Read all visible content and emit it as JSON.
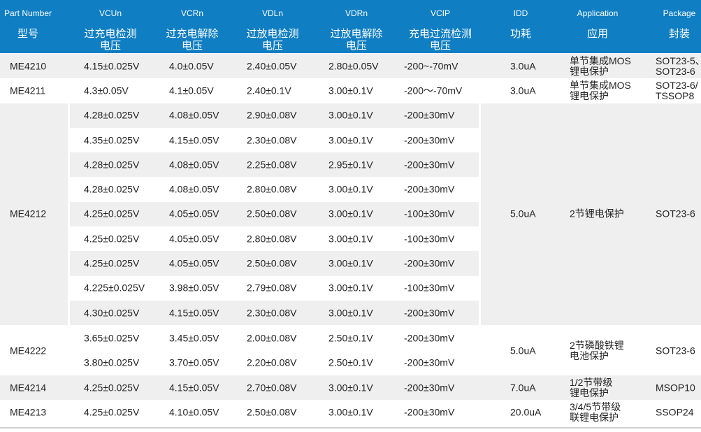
{
  "header": {
    "en": [
      "Part Number",
      "VCUn",
      "VCRn",
      "VDLn",
      "VDRn",
      "VCIP",
      "IDD",
      "Application",
      "Package"
    ],
    "zh": [
      "型号",
      "过充电检测\n电压",
      "过充电解除\n电压",
      "过放电检测\n电压",
      "过放电解除\n电压",
      "充电过流检测\n电压",
      "功耗",
      "应用",
      "封装"
    ]
  },
  "groups": [
    {
      "part": "ME4210",
      "rows": [
        [
          "4.15±0.025V",
          "4.0±0.05V",
          "2.40±0.05V",
          "2.80±0.05V",
          "-200~-70mV"
        ]
      ],
      "idd": "3.0uA",
      "application": "单节集成MOS\n锂电保护",
      "package": "SOT23-5、\nSOT23-6"
    },
    {
      "part": "ME4211",
      "rows": [
        [
          "4.3±0.05V",
          "4.1±0.05V",
          "2.40±0.1V",
          "3.00±0.1V",
          "-200～-70mV"
        ]
      ],
      "idd": "3.0uA",
      "application": "单节集成MOS\n锂电保护",
      "package": "SOT23-6/\nTSSOP8"
    },
    {
      "part": "ME4212",
      "rows": [
        [
          "4.28±0.025V",
          "4.08±0.05V",
          "2.90±0.08V",
          "3.00±0.1V",
          "-200±30mV"
        ],
        [
          "4.35±0.025V",
          "4.15±0.05V",
          "2.30±0.08V",
          "3.00±0.1V",
          "-200±30mV"
        ],
        [
          "4.28±0.025V",
          "4.08±0.05V",
          "2.25±0.08V",
          "2.95±0.1V",
          "-200±30mV"
        ],
        [
          "4.28±0.025V",
          "4.08±0.05V",
          "2.80±0.08V",
          "3.00±0.1V",
          "-200±30mV"
        ],
        [
          "4.25±0.025V",
          "4.05±0.05V",
          "2.50±0.08V",
          "3.00±0.1V",
          "-100±30mV"
        ],
        [
          "4.25±0.025V",
          "4.05±0.05V",
          "2.80±0.08V",
          "3.00±0.1V",
          "-100±30mV"
        ],
        [
          "4.25±0.025V",
          "4.05±0.05V",
          "2.50±0.08V",
          "3.00±0.1V",
          "-200±30mV"
        ],
        [
          "4.225±0.025V",
          "3.98±0.05V",
          "2.79±0.08V",
          "3.00±0.1V",
          "-100±30mV"
        ],
        [
          "4.30±0.025V",
          "4.15±0.05V",
          "2.30±0.08V",
          "3.00±0.1V",
          "-200±30mV"
        ]
      ],
      "idd": "5.0uA",
      "application": "2节锂电保护",
      "package": "SOT23-6"
    },
    {
      "part": "ME4222",
      "rows": [
        [
          "3.65±0.025V",
          "3.45±0.05V",
          "2.00±0.08V",
          "2.50±0.1V",
          "-200±30mV"
        ],
        [
          "3.80±0.025V",
          "3.70±0.05V",
          "2.20±0.08V",
          "2.50±0.1V",
          "-200±30mV"
        ]
      ],
      "idd": "5.0uA",
      "application": "2节磷酸铁锂\n电池保护",
      "package": "SOT23-6"
    },
    {
      "part": "ME4214",
      "rows": [
        [
          "4.25±0.025V",
          "4.15±0.05V",
          "2.70±0.08V",
          "3.00±0.1V",
          "-200±30mV"
        ]
      ],
      "idd": "7.0uA",
      "application": "1/2节带级\n锂电保护",
      "package": "MSOP10"
    },
    {
      "part": "ME4213",
      "rows": [
        [
          "4.25±0.025V",
          "4.10±0.05V",
          "2.50±0.08V",
          "3.00±0.1V",
          "-200±30mV"
        ]
      ],
      "idd": "20.0uA",
      "application": "3/4/5节带级\n联锂电保护",
      "package": "SSOP24"
    }
  ],
  "colors": {
    "header": "#0f7ec3",
    "stripe": "#efefef"
  }
}
